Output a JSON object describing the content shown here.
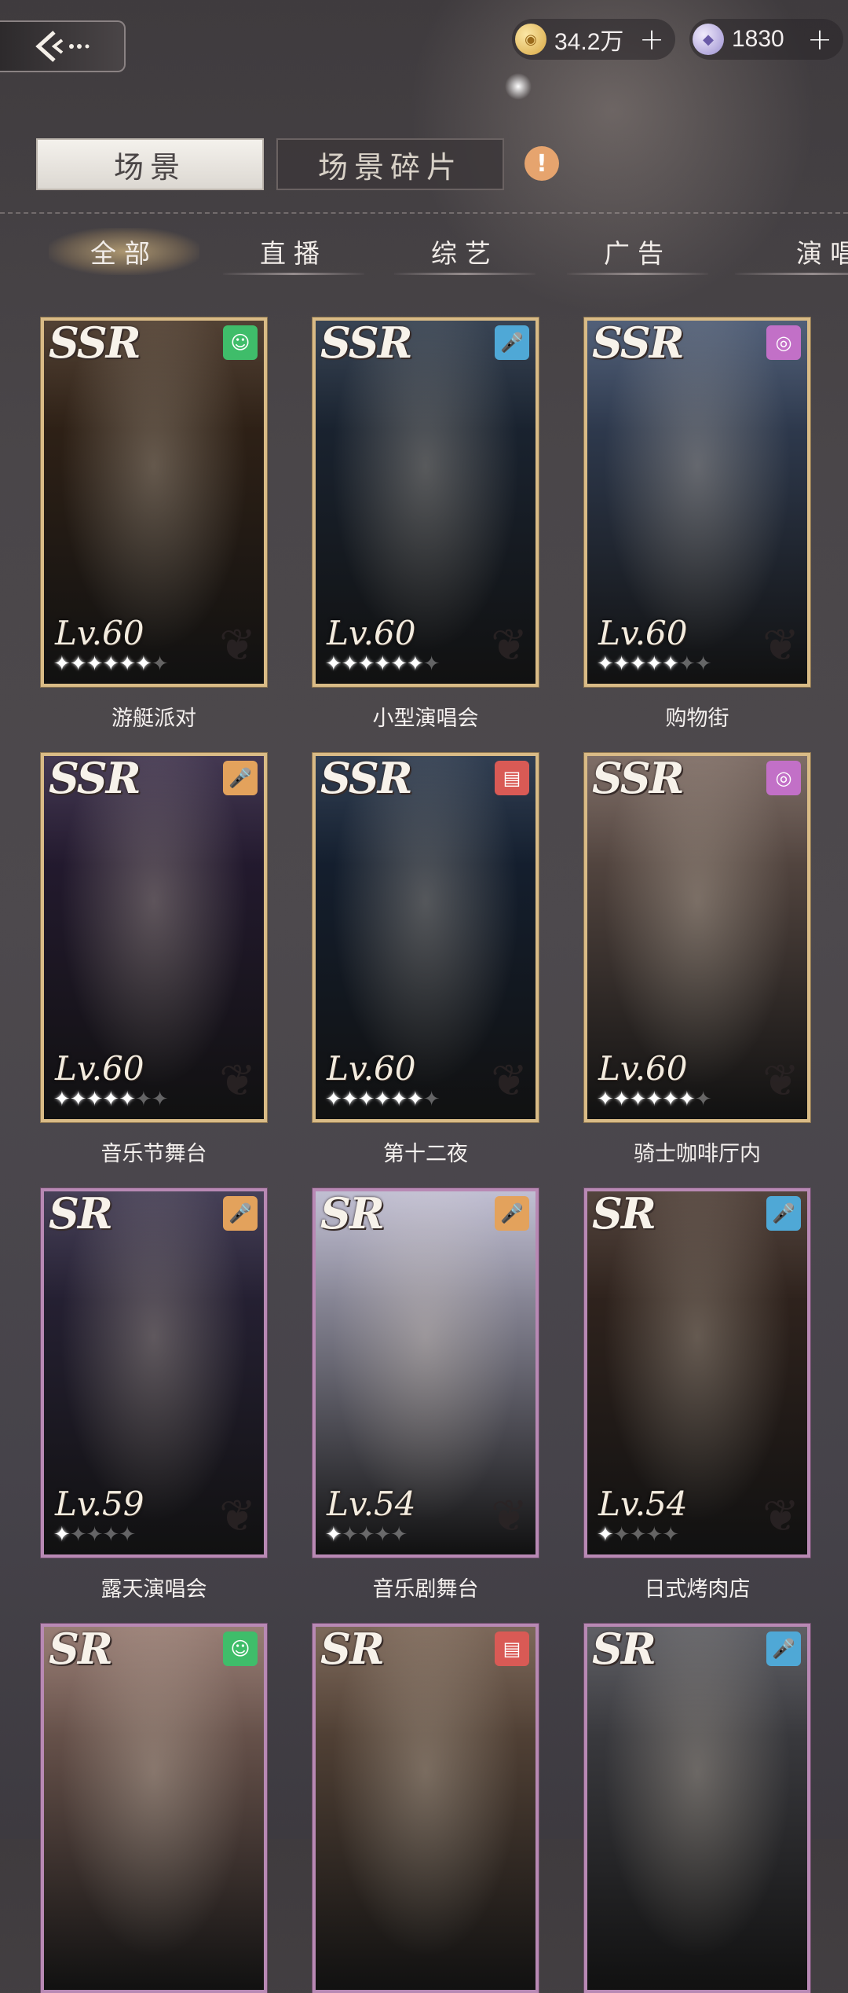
{
  "top_bar": {
    "gold": {
      "value": "34.2万",
      "icon": "gold-coin-icon",
      "plus": "+"
    },
    "diamond": {
      "value": "1830",
      "icon": "diamond-icon",
      "plus": "+"
    }
  },
  "mode_tabs": [
    {
      "label": "场景",
      "active": true
    },
    {
      "label": "场景碎片",
      "active": false
    }
  ],
  "alert_icon": "!",
  "category_tabs": [
    {
      "label": "全部",
      "active": true
    },
    {
      "label": "直播",
      "active": false
    },
    {
      "label": "综艺",
      "active": false
    },
    {
      "label": "广告",
      "active": false
    },
    {
      "label": "演唱",
      "active": false
    }
  ],
  "cards": [
    {
      "name": "游艇派对",
      "rarity": "SSR",
      "level": "Lv.60",
      "stars": 6,
      "max_stars": 7,
      "type_icon": "smile-icon",
      "badge_color": "#3fbd6a",
      "theme": "#3a2718"
    },
    {
      "name": "小型演唱会",
      "rarity": "SSR",
      "level": "Lv.60",
      "stars": 6,
      "max_stars": 7,
      "type_icon": "microphone-icon",
      "badge_color": "#4fa8d6",
      "theme": "#1d2a3c"
    },
    {
      "name": "购物街",
      "rarity": "SSR",
      "level": "Lv.60",
      "stars": 5,
      "max_stars": 7,
      "type_icon": "camera-icon",
      "badge_color": "#c270c7",
      "theme": "#3a4a66"
    },
    {
      "name": "音乐节舞台",
      "rarity": "SSR",
      "level": "Lv.60",
      "stars": 5,
      "max_stars": 7,
      "type_icon": "microphone-icon",
      "badge_color": "#e3a25c",
      "theme": "#2a1d3a"
    },
    {
      "name": "第十二夜",
      "rarity": "SSR",
      "level": "Lv.60",
      "stars": 6,
      "max_stars": 7,
      "type_icon": "clapperboard-icon",
      "badge_color": "#d95a55",
      "theme": "#15243a"
    },
    {
      "name": "骑士咖啡厅内",
      "rarity": "SSR",
      "level": "Lv.60",
      "stars": 6,
      "max_stars": 7,
      "type_icon": "camera-icon",
      "badge_color": "#c270c7",
      "theme": "#6d5a52"
    },
    {
      "name": "露天演唱会",
      "rarity": "SR",
      "level": "Lv.59",
      "stars": 1,
      "max_stars": 5,
      "type_icon": "microphone-icon",
      "badge_color": "#e3a25c",
      "theme": "#2d2640"
    },
    {
      "name": "音乐剧舞台",
      "rarity": "SR",
      "level": "Lv.54",
      "stars": 1,
      "max_stars": 5,
      "type_icon": "microphone-icon",
      "badge_color": "#e3a25c",
      "theme": "#b8b6cc"
    },
    {
      "name": "日式烤肉店",
      "rarity": "SR",
      "level": "Lv.54",
      "stars": 1,
      "max_stars": 5,
      "type_icon": "microphone-icon",
      "badge_color": "#4fa8d6",
      "theme": "#3b2a22"
    },
    {
      "name": "",
      "rarity": "SR",
      "level": "",
      "stars": 0,
      "max_stars": 0,
      "type_icon": "smile-icon",
      "badge_color": "#3fbd6a",
      "theme": "#8a6c62"
    },
    {
      "name": "",
      "rarity": "SR",
      "level": "",
      "stars": 0,
      "max_stars": 0,
      "type_icon": "clapperboard-icon",
      "badge_color": "#d95a55",
      "theme": "#6b5444"
    },
    {
      "name": "",
      "rarity": "SR",
      "level": "",
      "stars": 0,
      "max_stars": 0,
      "type_icon": "microphone-icon",
      "badge_color": "#4fa8d6",
      "theme": "#4a4a50"
    }
  ]
}
